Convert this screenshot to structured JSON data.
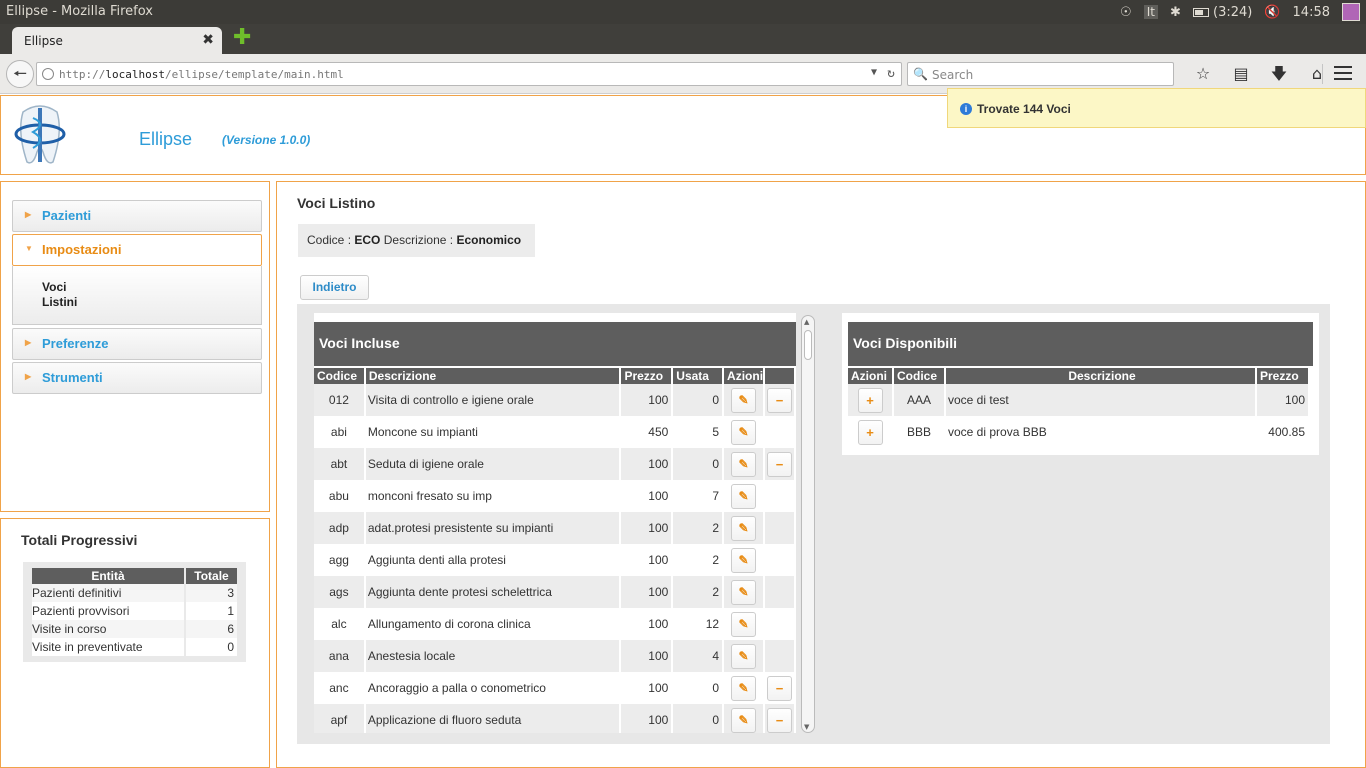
{
  "os": {
    "window_title": "Ellipse - Mozilla Firefox",
    "keyboard_layout": "It",
    "battery_time": "(3:24)",
    "clock": "14:58"
  },
  "browser": {
    "tab_title": "Ellipse",
    "url_prefix": "http://",
    "url_host": "localhost",
    "url_path": "/ellipse/template/main.html",
    "search_placeholder": "Search"
  },
  "header": {
    "app_name": "Ellipse",
    "version": "(Versione 1.0.0)"
  },
  "sidebar": {
    "items": [
      {
        "label": "Pazienti"
      },
      {
        "label": "Impostazioni"
      },
      {
        "label": "Preferenze"
      },
      {
        "label": "Strumenti"
      }
    ],
    "subitems": [
      {
        "label": "Voci"
      },
      {
        "label": "Listini"
      }
    ]
  },
  "totals": {
    "title": "Totali Progressivi",
    "headers": [
      "Entità",
      "Totale"
    ],
    "rows": [
      {
        "entity": "Pazienti definitivi",
        "total": "3"
      },
      {
        "entity": "Pazienti provvisori",
        "total": "1"
      },
      {
        "entity": "Visite in corso",
        "total": "6"
      },
      {
        "entity": "Visite in preventivate",
        "total": "0"
      }
    ]
  },
  "notice": {
    "text": "Trovate 144 Voci"
  },
  "main": {
    "title": "Voci Listino",
    "code_label": "Codice :",
    "code_value": "ECO",
    "desc_label": "Descrizione :",
    "desc_value": "Economico",
    "back_button": "Indietro"
  },
  "included": {
    "title": "Voci Incluse",
    "headers": [
      "Codice",
      "Descrizione",
      "Prezzo",
      "Usata",
      "Azioni"
    ],
    "rows": [
      {
        "code": "012",
        "desc": "Visita di controllo e igiene orale",
        "price": "100",
        "used": "0"
      },
      {
        "code": "abi",
        "desc": "Moncone su impianti",
        "price": "450",
        "used": "5"
      },
      {
        "code": "abt",
        "desc": "Seduta di igiene orale",
        "price": "100",
        "used": "0"
      },
      {
        "code": "abu",
        "desc": "monconi fresato su imp",
        "price": "100",
        "used": "7"
      },
      {
        "code": "adp",
        "desc": "adat.protesi presistente su impianti",
        "price": "100",
        "used": "2"
      },
      {
        "code": "agg",
        "desc": "Aggiunta denti alla protesi",
        "price": "100",
        "used": "2"
      },
      {
        "code": "ags",
        "desc": "Aggiunta dente protesi schelettrica",
        "price": "100",
        "used": "2"
      },
      {
        "code": "alc",
        "desc": "Allungamento di corona clinica",
        "price": "100",
        "used": "12"
      },
      {
        "code": "ana",
        "desc": "Anestesia locale",
        "price": "100",
        "used": "4"
      },
      {
        "code": "anc",
        "desc": "Ancoraggio a palla o conometrico",
        "price": "100",
        "used": "0"
      },
      {
        "code": "apf",
        "desc": "Applicazione di fluoro seduta",
        "price": "100",
        "used": "0"
      }
    ]
  },
  "available": {
    "title": "Voci Disponibili",
    "headers": [
      "Azioni",
      "Codice",
      "Descrizione",
      "Prezzo"
    ],
    "rows": [
      {
        "code": "AAA",
        "desc": "voce di test",
        "price": "100"
      },
      {
        "code": "BBB",
        "desc": "voce di prova BBB",
        "price": "400.85"
      }
    ]
  },
  "icons": {
    "edit": "pencil-icon",
    "remove": "minus-icon",
    "add": "plus-icon",
    "info": "info-icon"
  },
  "colors": {
    "accent_orange": "#f0a349",
    "link_blue": "#2e9cd8",
    "table_header": "#5e5e5e",
    "notice_bg": "#fcf7c6"
  }
}
